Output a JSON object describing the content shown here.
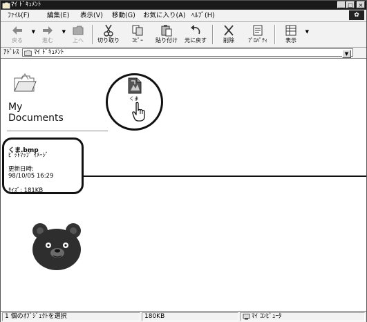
{
  "window": {
    "title": "ﾏｲ ﾄﾞｷｭﾒﾝﾄ"
  },
  "menu": {
    "items": [
      "ﾌｧｲﾙ(F)",
      "編集(E)",
      "表示(V)",
      "移動(G)",
      "お気に入り(A)",
      "ﾍﾙﾌﾟ(H)"
    ]
  },
  "toolbar": {
    "back": "戻る",
    "forward": "進む",
    "up": "上へ",
    "cut": "切り取り",
    "copy": "ｺﾋﾟｰ",
    "paste": "貼り付け",
    "undo": "元に戻す",
    "delete": "削除",
    "properties": "ﾌﾟﾛﾊﾟﾃｨ",
    "views": "表示"
  },
  "address": {
    "label": "ｱﾄﾞﾚｽ",
    "value": "ﾏｲ ﾄﾞｷｭﾒﾝﾄ"
  },
  "panel": {
    "title_line1": "My",
    "title_line2": "Documents",
    "filename": "くま.bmp",
    "filetype": "ﾋﾞｯﾄﾏｯﾌﾟ ｲﾒｰｼﾞ",
    "modified_label": "更新日時:",
    "modified_value": "98/10/05 16:29",
    "size_text": "ｻｲｽﾞ: 181KB"
  },
  "file_icon": {
    "label": "くま"
  },
  "status": {
    "selection": "1 個のｵﾌﾞｼﾞｪｸﾄを選択",
    "size": "180KB",
    "location": "ﾏｲ ｺﾝﾋﾟｭｰﾀ"
  }
}
